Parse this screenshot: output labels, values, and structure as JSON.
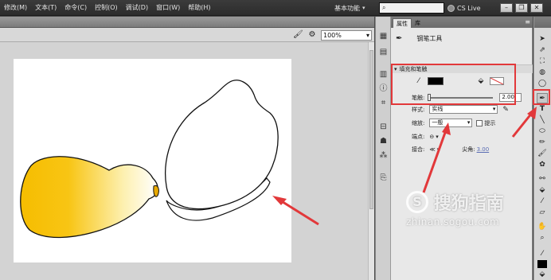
{
  "menubar": {
    "items": [
      "修改(M)",
      "文本(T)",
      "命令(C)",
      "控制(O)",
      "调试(D)",
      "窗口(W)",
      "帮助(H)"
    ],
    "workspace": "基本功能",
    "search_placeholder": "",
    "cslive": "CS Live"
  },
  "edit_bar": {
    "zoom": "100%"
  },
  "properties": {
    "tabs": [
      "属性",
      "库"
    ],
    "tool_name": "钢笔工具",
    "section_fill_stroke": "填充和笔触",
    "stroke_label": "笔触:",
    "stroke_value": "2.00",
    "style_label": "样式:",
    "style_value": "实线",
    "scale_label": "缩放:",
    "scale_value": "一般",
    "hint_label": "提示",
    "cap_label": "端点:",
    "join_label": "接合:",
    "miter_label": "尖角:",
    "miter_value": "3.00"
  },
  "colors": {
    "annotation_red": "#e2383a",
    "fill_yellow": "#f6bf00",
    "stroke_black": "#000000"
  },
  "watermark": {
    "name": "搜狗指南",
    "url": "zhinan.sogou.com"
  }
}
